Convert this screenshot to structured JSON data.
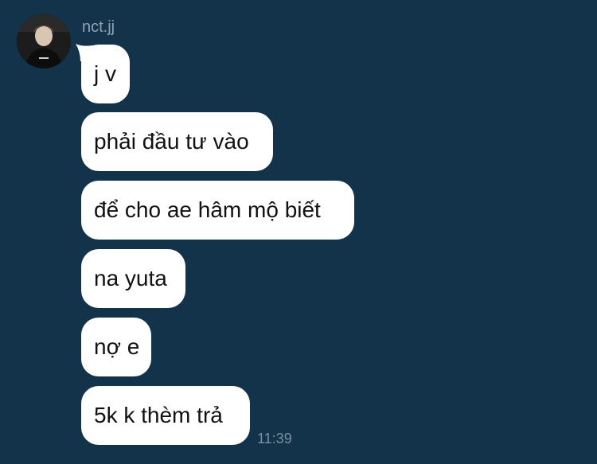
{
  "chat": {
    "sender_name": "nct.jj",
    "avatar_icon": "profile-photo-icon",
    "messages": [
      {
        "text": "j v"
      },
      {
        "text": "phải đầu tư vào"
      },
      {
        "text": "để cho ae hâm mộ biết"
      },
      {
        "text": "na yuta"
      },
      {
        "text": "nợ e"
      },
      {
        "text": "5k k thèm trả"
      }
    ],
    "timestamp": "11:39"
  },
  "colors": {
    "background": "#12334a",
    "bubble": "#ffffff",
    "text": "#111111",
    "meta_text": "#8ea3b3"
  }
}
